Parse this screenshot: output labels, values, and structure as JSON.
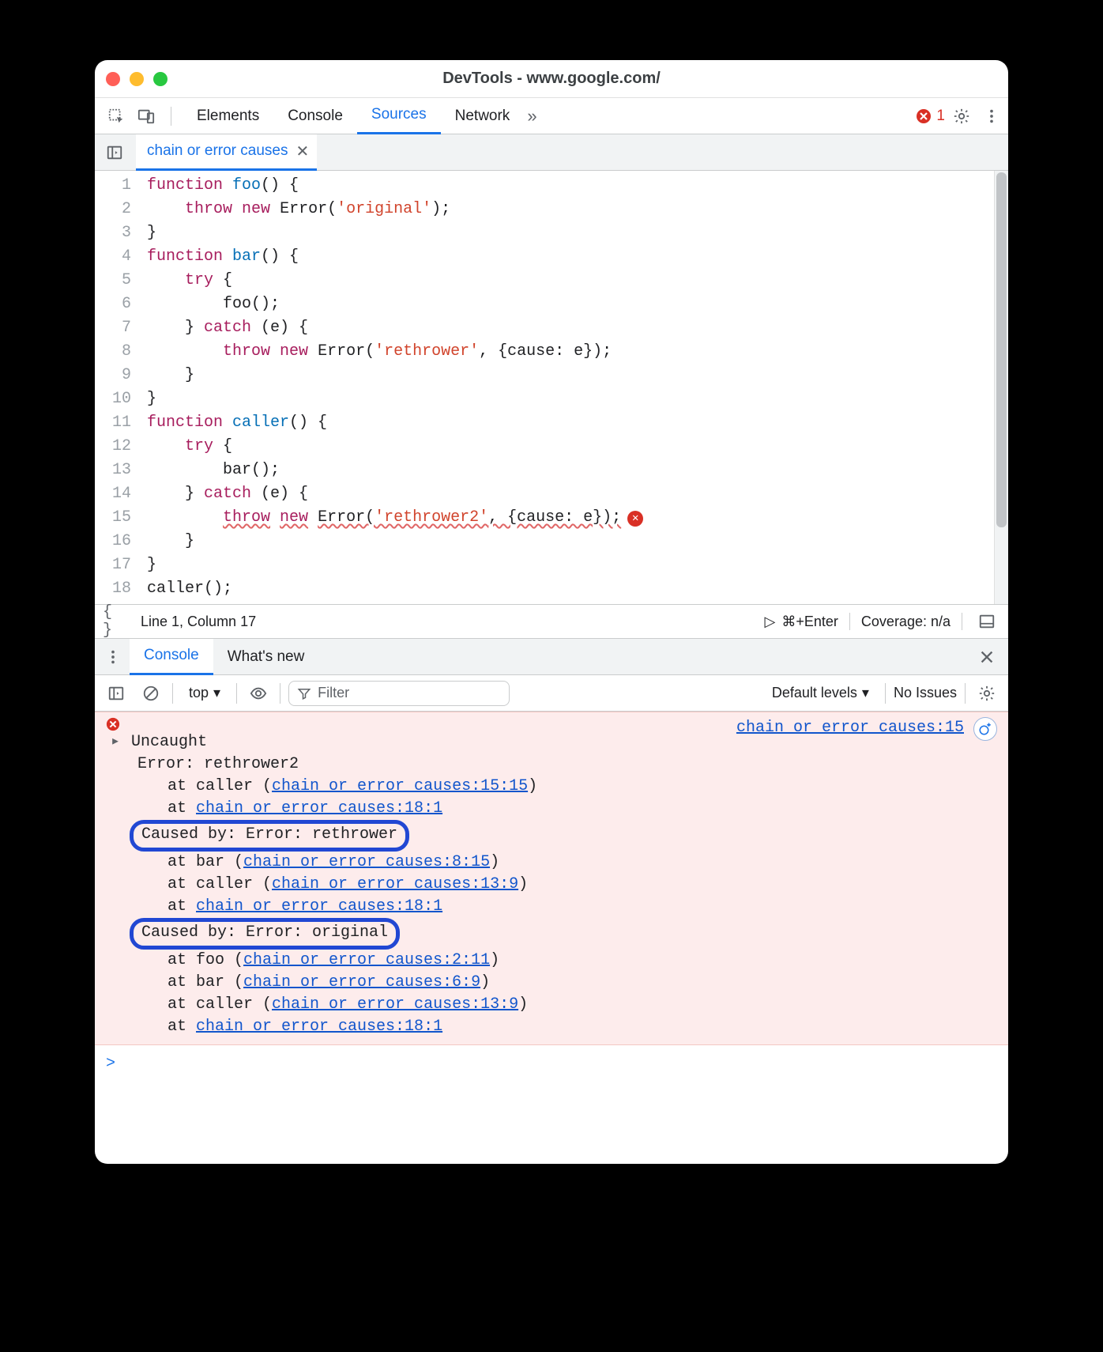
{
  "window": {
    "title": "DevTools - www.google.com/"
  },
  "main_tabs": {
    "items": [
      "Elements",
      "Console",
      "Sources",
      "Network"
    ],
    "active": "Sources",
    "more": "»",
    "error_count": "1"
  },
  "file_tab": {
    "name": "chain or error causes"
  },
  "editor": {
    "lines": [
      {
        "n": "1",
        "tokens": [
          {
            "t": "kw",
            "v": "function"
          },
          {
            "t": "sp",
            "v": " "
          },
          {
            "t": "fn",
            "v": "foo"
          },
          {
            "t": "pl",
            "v": "() {"
          }
        ]
      },
      {
        "n": "2",
        "indent": 1,
        "tokens": [
          {
            "t": "kw",
            "v": "throw"
          },
          {
            "t": "sp",
            "v": " "
          },
          {
            "t": "kw",
            "v": "new"
          },
          {
            "t": "sp",
            "v": " "
          },
          {
            "t": "pl",
            "v": "Error("
          },
          {
            "t": "str",
            "v": "'original'"
          },
          {
            "t": "pl",
            "v": ");"
          }
        ]
      },
      {
        "n": "3",
        "tokens": [
          {
            "t": "pl",
            "v": "}"
          }
        ]
      },
      {
        "n": "4",
        "tokens": [
          {
            "t": "kw",
            "v": "function"
          },
          {
            "t": "sp",
            "v": " "
          },
          {
            "t": "fn",
            "v": "bar"
          },
          {
            "t": "pl",
            "v": "() {"
          }
        ]
      },
      {
        "n": "5",
        "indent": 1,
        "tokens": [
          {
            "t": "kw",
            "v": "try"
          },
          {
            "t": "sp",
            "v": " "
          },
          {
            "t": "pl",
            "v": "{"
          }
        ]
      },
      {
        "n": "6",
        "indent": 2,
        "tokens": [
          {
            "t": "pl",
            "v": "foo();"
          }
        ]
      },
      {
        "n": "7",
        "indent": 1,
        "tokens": [
          {
            "t": "pl",
            "v": "} "
          },
          {
            "t": "kw",
            "v": "catch"
          },
          {
            "t": "sp",
            "v": " "
          },
          {
            "t": "pl",
            "v": "(e) {"
          }
        ]
      },
      {
        "n": "8",
        "indent": 2,
        "tokens": [
          {
            "t": "kw",
            "v": "throw"
          },
          {
            "t": "sp",
            "v": " "
          },
          {
            "t": "kw",
            "v": "new"
          },
          {
            "t": "sp",
            "v": " "
          },
          {
            "t": "pl",
            "v": "Error("
          },
          {
            "t": "str",
            "v": "'rethrower'"
          },
          {
            "t": "pl",
            "v": ", {cause: e});"
          }
        ]
      },
      {
        "n": "9",
        "indent": 1,
        "tokens": [
          {
            "t": "pl",
            "v": "}"
          }
        ]
      },
      {
        "n": "10",
        "tokens": [
          {
            "t": "pl",
            "v": "}"
          }
        ]
      },
      {
        "n": "11",
        "tokens": [
          {
            "t": "kw",
            "v": "function"
          },
          {
            "t": "sp",
            "v": " "
          },
          {
            "t": "fn",
            "v": "caller"
          },
          {
            "t": "pl",
            "v": "() {"
          }
        ]
      },
      {
        "n": "12",
        "indent": 1,
        "tokens": [
          {
            "t": "kw",
            "v": "try"
          },
          {
            "t": "sp",
            "v": " "
          },
          {
            "t": "pl",
            "v": "{"
          }
        ]
      },
      {
        "n": "13",
        "indent": 2,
        "tokens": [
          {
            "t": "pl",
            "v": "bar();"
          }
        ]
      },
      {
        "n": "14",
        "indent": 1,
        "tokens": [
          {
            "t": "pl",
            "v": "} "
          },
          {
            "t": "kw",
            "v": "catch"
          },
          {
            "t": "sp",
            "v": " "
          },
          {
            "t": "pl",
            "v": "(e) {"
          }
        ]
      },
      {
        "n": "15",
        "indent": 2,
        "wavy": true,
        "err": true,
        "tokens": [
          {
            "t": "kw",
            "v": "throw"
          },
          {
            "t": "sp",
            "v": " "
          },
          {
            "t": "kw",
            "v": "new"
          },
          {
            "t": "sp",
            "v": " "
          },
          {
            "t": "pl",
            "v": "Error("
          },
          {
            "t": "str",
            "v": "'rethrower2'"
          },
          {
            "t": "pl",
            "v": ", {cause: e});"
          }
        ]
      },
      {
        "n": "16",
        "indent": 1,
        "tokens": [
          {
            "t": "pl",
            "v": "}"
          }
        ]
      },
      {
        "n": "17",
        "tokens": [
          {
            "t": "pl",
            "v": "}"
          }
        ]
      },
      {
        "n": "18",
        "tokens": [
          {
            "t": "pl",
            "v": "caller();"
          }
        ]
      }
    ]
  },
  "statusbar": {
    "cursor": "Line 1, Column 17",
    "shortcut": "⌘+Enter",
    "coverage": "Coverage: n/a"
  },
  "drawer_tabs": {
    "items": [
      "Console",
      "What's new"
    ],
    "active": "Console"
  },
  "console_toolbar": {
    "context": "top",
    "filter_placeholder": "Filter",
    "levels": "Default levels",
    "issues": "No Issues"
  },
  "console": {
    "right_link": "chain or error causes:15",
    "lines": [
      {
        "cls": "head",
        "icon": true,
        "tri": true,
        "text": "Uncaught"
      },
      {
        "cls": "indent1",
        "text": "Error: rethrower2"
      },
      {
        "cls": "indent2",
        "pre": "at caller (",
        "link": "chain or error causes:15:15",
        "post": ")"
      },
      {
        "cls": "indent2",
        "pre": "at ",
        "link": "chain or error causes:18:1"
      },
      {
        "cls": "hl",
        "text": "Caused by: Error: rethrower"
      },
      {
        "cls": "indent2",
        "pre": "at bar (",
        "link": "chain or error causes:8:15",
        "post": ")"
      },
      {
        "cls": "indent2",
        "pre": "at caller (",
        "link": "chain or error causes:13:9",
        "post": ")"
      },
      {
        "cls": "indent2",
        "pre": "at ",
        "link": "chain or error causes:18:1"
      },
      {
        "cls": "hl",
        "text": "Caused by: Error: original"
      },
      {
        "cls": "indent2",
        "pre": "at foo (",
        "link": "chain or error causes:2:11",
        "post": ")"
      },
      {
        "cls": "indent2",
        "pre": "at bar (",
        "link": "chain or error causes:6:9",
        "post": ")"
      },
      {
        "cls": "indent2",
        "pre": "at caller (",
        "link": "chain or error causes:13:9",
        "post": ")"
      },
      {
        "cls": "indent2",
        "pre": "at ",
        "link": "chain or error causes:18:1"
      }
    ],
    "prompt": ">"
  }
}
